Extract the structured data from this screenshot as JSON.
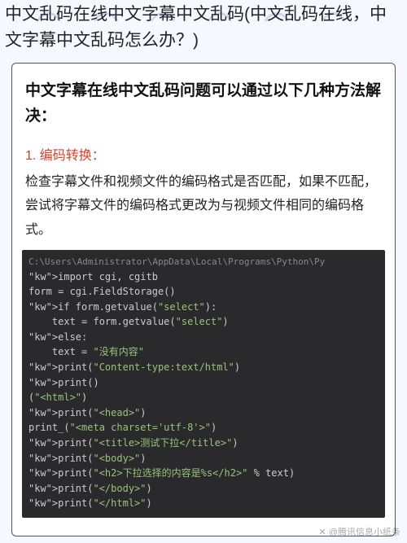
{
  "page": {
    "title": "中文乱码在线中文字幕中文乱码(中文乱码在线，中文字幕中文乱码怎么办？)"
  },
  "card": {
    "heading": "中文字幕在线中文乱码问题可以通过以下几种方法解决：",
    "method1": {
      "title": "1. 编码转换：",
      "body": "检查字幕文件和视频文件的编码格式是否匹配，如果不匹配，尝试将字幕文件的编码格式更改为与视频文件相同的编码格式。"
    }
  },
  "code": {
    "path": "C:\\Users\\Administrator\\AppData\\Local\\Programs\\Python\\Py",
    "lines": [
      {
        "raw": "import cgi, cgitb"
      },
      {
        "raw": "form = cgi.FieldStorage()"
      },
      {
        "raw": "if form.getvalue(\"select\"):"
      },
      {
        "raw": "    text = form.getvalue(\"select\")"
      },
      {
        "raw": "else:"
      },
      {
        "raw": "    text = \"没有内容\""
      },
      {
        "raw": "print(\"Content-type:text/html\")"
      },
      {
        "raw": "print()"
      },
      {
        "raw": "(\"<html>\")"
      },
      {
        "raw": "print(\"<head>\")"
      },
      {
        "raw": "print_(\"<meta charset='utf-8'>\")"
      },
      {
        "raw": "print(\"<title>测试下拉</title>\")"
      },
      {
        "raw": "print(\"<body>\")"
      },
      {
        "raw": "print(\"<h2>下拉选择的内容是%s</h2>\" % text)"
      },
      {
        "raw": "print(\"</body>\")"
      },
      {
        "raw": "print(\"</html>\")"
      }
    ]
  },
  "watermark": "✕ @腾讯信息小纸条"
}
